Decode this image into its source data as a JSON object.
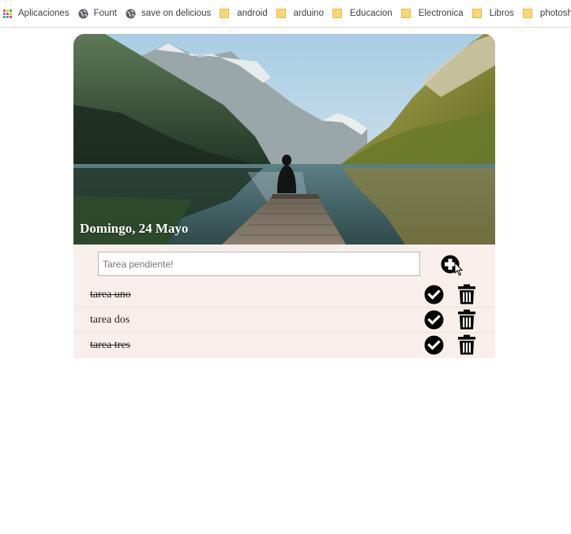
{
  "bookmarks": [
    {
      "label": "Aplicaciones",
      "icon": "apps-grid-icon"
    },
    {
      "label": "Fount",
      "icon": "globe-icon"
    },
    {
      "label": "save on delicious",
      "icon": "globe-icon"
    },
    {
      "label": "android",
      "icon": "folder-icon"
    },
    {
      "label": "arduino",
      "icon": "folder-icon"
    },
    {
      "label": "Educacion",
      "icon": "folder-icon"
    },
    {
      "label": "Electronica",
      "icon": "folder-icon"
    },
    {
      "label": "Libros",
      "icon": "folder-icon"
    },
    {
      "label": "photosho",
      "icon": "folder-icon"
    }
  ],
  "header": {
    "date": "Domingo, 24 Mayo",
    "image": "mountain-lake-dock-photo"
  },
  "new_task": {
    "placeholder": "Tarea pendiente!",
    "value": "",
    "add_icon": "plus-circle-icon"
  },
  "tasks": [
    {
      "text": "tarea uno",
      "done": true
    },
    {
      "text": "tarea dos",
      "done": false
    },
    {
      "text": "tarea tres",
      "done": true
    }
  ],
  "colors": {
    "panel_bg": "#f8efed",
    "icon": "#000000",
    "folder": "#f8d775"
  }
}
